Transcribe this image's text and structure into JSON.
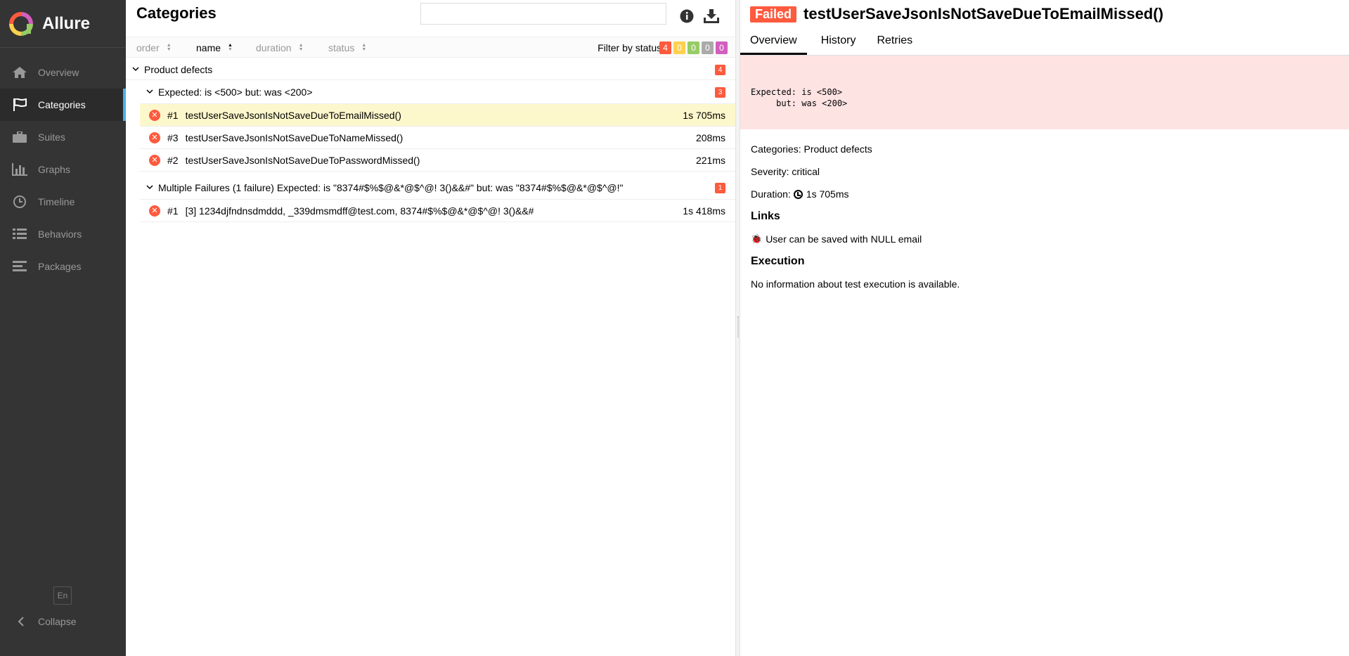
{
  "app": {
    "name": "Allure"
  },
  "sidebar": {
    "items": [
      {
        "label": "Overview",
        "icon": "home-icon"
      },
      {
        "label": "Categories",
        "icon": "flag-icon",
        "active": true
      },
      {
        "label": "Suites",
        "icon": "briefcase-icon"
      },
      {
        "label": "Graphs",
        "icon": "bar-chart-icon"
      },
      {
        "label": "Timeline",
        "icon": "clock-icon"
      },
      {
        "label": "Behaviors",
        "icon": "list-icon"
      },
      {
        "label": "Packages",
        "icon": "align-left-icon"
      }
    ],
    "language": "En",
    "collapse_label": "Collapse"
  },
  "categories_pane": {
    "title": "Categories",
    "search": {
      "value": "",
      "placeholder": ""
    },
    "sorters": [
      {
        "label": "order",
        "active": false
      },
      {
        "label": "name",
        "active": true
      },
      {
        "label": "duration",
        "active": false
      },
      {
        "label": "status",
        "active": false
      }
    ],
    "filter_label": "Filter by status:",
    "status_filters": [
      {
        "count": "4",
        "color": "#fd5a3e",
        "status": "failed"
      },
      {
        "count": "0",
        "color": "#ffd050",
        "status": "broken"
      },
      {
        "count": "0",
        "color": "#97cc64",
        "status": "passed"
      },
      {
        "count": "0",
        "color": "#aaaaaa",
        "status": "skipped"
      },
      {
        "count": "0",
        "color": "#d35ebe",
        "status": "unknown"
      }
    ],
    "groups": [
      {
        "name": "Product defects",
        "count": "4",
        "subgroups": [
          {
            "name": "Expected: is <500> but: was <200>",
            "count": "3",
            "tests": [
              {
                "order": "#1",
                "name": "testUserSaveJsonIsNotSaveDueToEmailMissed()",
                "duration": "1s 705ms",
                "selected": true
              },
              {
                "order": "#3",
                "name": "testUserSaveJsonIsNotSaveDueToNameMissed()",
                "duration": "208ms"
              },
              {
                "order": "#2",
                "name": "testUserSaveJsonIsNotSaveDueToPasswordMissed()",
                "duration": "221ms"
              }
            ]
          },
          {
            "name": "Multiple Failures (1 failure) Expected: is \"8374#$%$@&*@$^@! 3()&&#\" but: was \"8374#$%$@&*@$^@!\"",
            "count": "1",
            "tests": [
              {
                "order": "#1",
                "name": "[3] 1234djfndnsdmddd, _339dmsmdff@test.com, 8374#$%$@&*@$^@! 3()&&#",
                "duration": "1s 418ms"
              }
            ]
          }
        ]
      }
    ]
  },
  "detail": {
    "status": "Failed",
    "title": "testUserSaveJsonIsNotSaveDueToEmailMissed()",
    "tabs": [
      "Overview",
      "History",
      "Retries"
    ],
    "error_message": "Expected: is <500>\n     but: was <200>",
    "categories_line": "Categories: Product defects",
    "severity_line": "Severity: critical",
    "duration_prefix": "Duration:",
    "duration_value": "1s 705ms",
    "links_title": "Links",
    "link_text": "User can be saved with NULL email",
    "execution_title": "Execution",
    "execution_text": "No information about test execution is available."
  },
  "colors": {
    "sidebar_bg": "#343434",
    "accent": "#4ab1e6",
    "failed": "#fd5a3e",
    "selected_row": "#fdf7cc",
    "error_bg": "#fee3e3"
  }
}
